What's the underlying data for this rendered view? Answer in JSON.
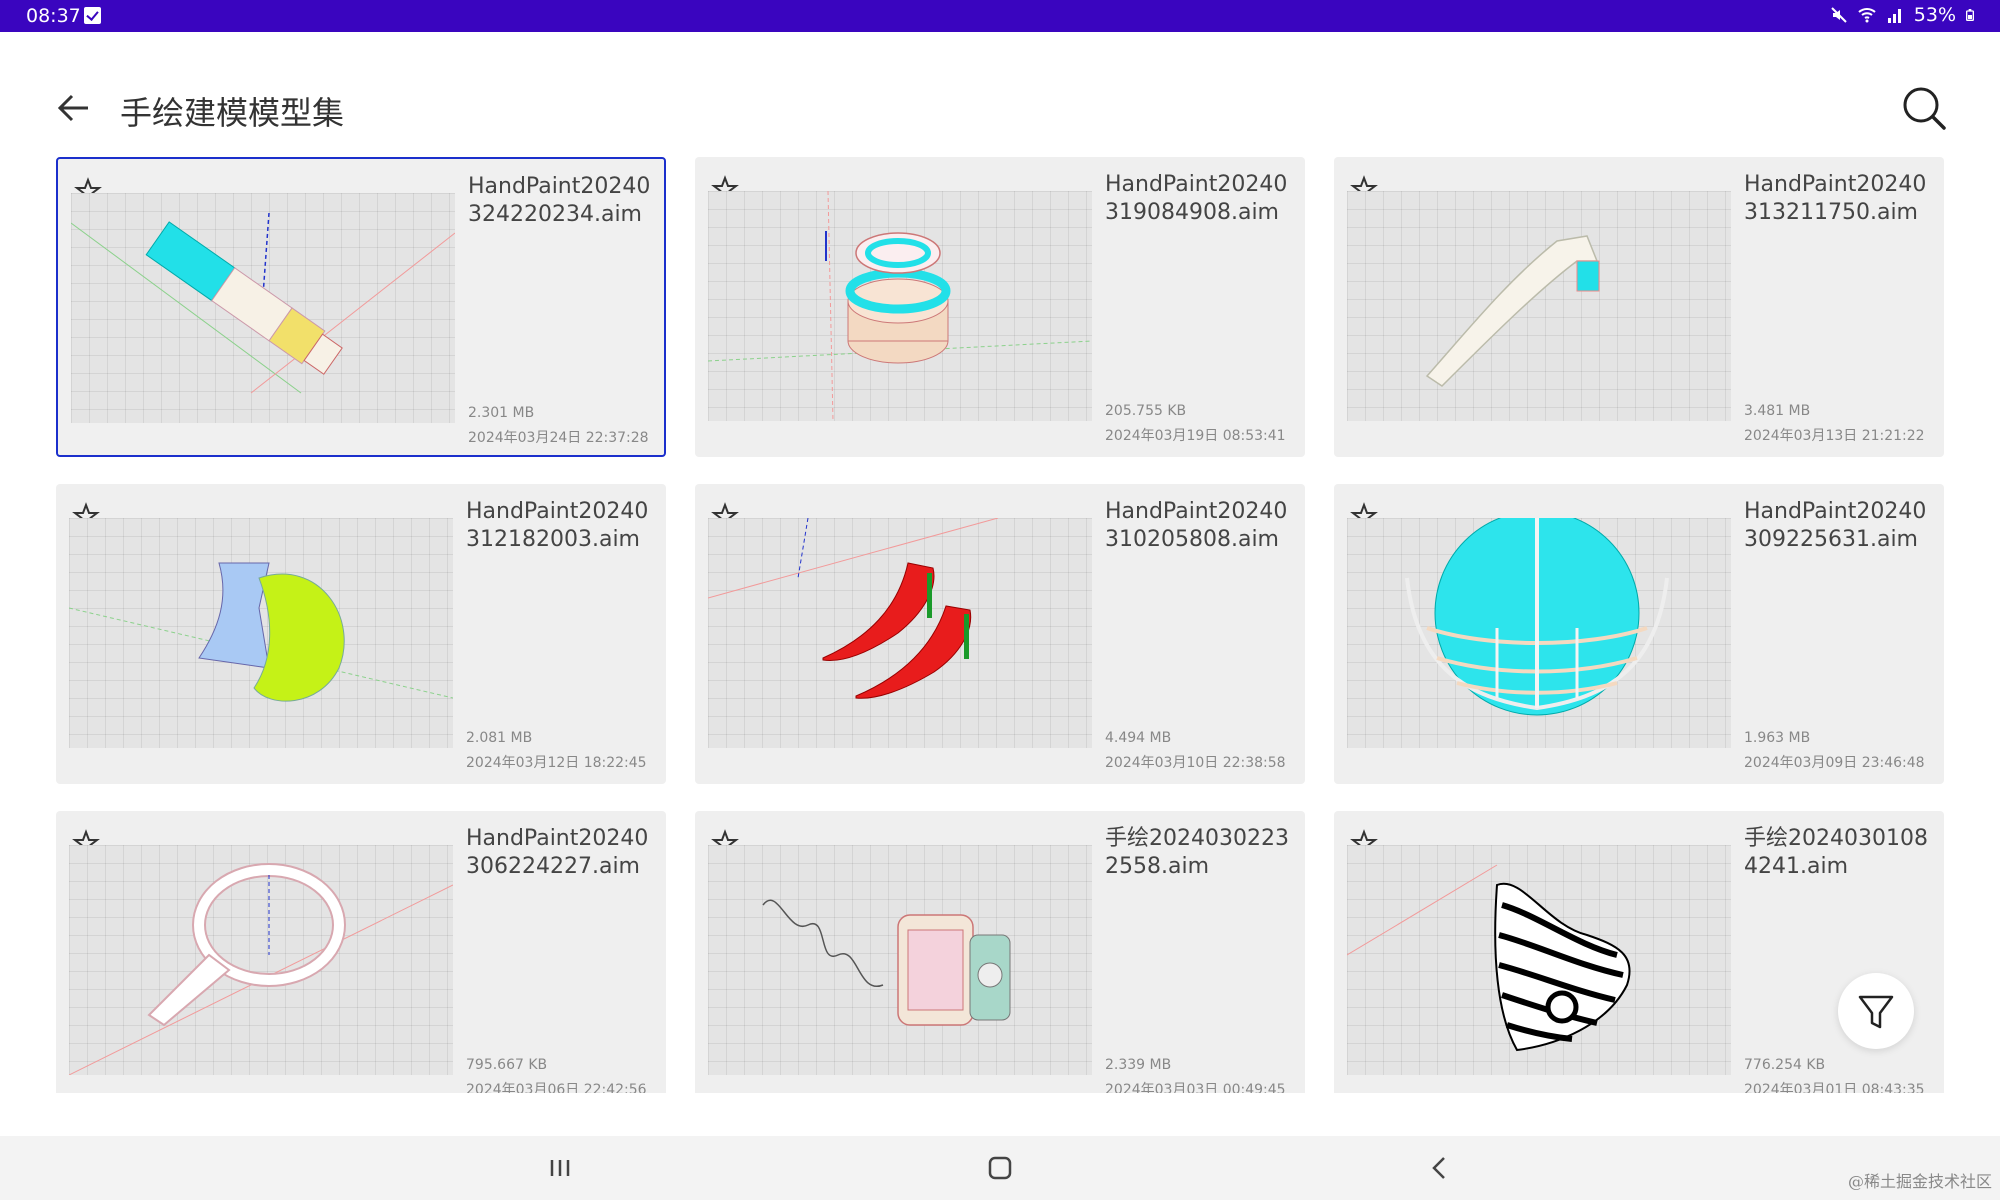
{
  "status_bar": {
    "time": "08:37",
    "battery": "53%"
  },
  "app_bar": {
    "title": "手绘建模模型集"
  },
  "files": [
    {
      "name": "HandPaint20240324220234.aim",
      "size": "2.301 MB",
      "date": "2024年03月24日 22:37:28",
      "selected": true,
      "model": "pen"
    },
    {
      "name": "HandPaint20240319084908.aim",
      "size": "205.755 KB",
      "date": "2024年03月19日 08:53:41",
      "selected": false,
      "model": "rings"
    },
    {
      "name": "HandPaint20240313211750.aim",
      "size": "3.481 MB",
      "date": "2024年03月13日 21:21:22",
      "selected": false,
      "model": "faucet"
    },
    {
      "name": "HandPaint20240312182003.aim",
      "size": "2.081 MB",
      "date": "2024年03月12日 18:22:45",
      "selected": false,
      "model": "shell"
    },
    {
      "name": "HandPaint20240310205808.aim",
      "size": "4.494 MB",
      "date": "2024年03月10日 22:38:58",
      "selected": false,
      "model": "heels"
    },
    {
      "name": "HandPaint20240309225631.aim",
      "size": "1.963 MB",
      "date": "2024年03月09日 23:46:48",
      "selected": false,
      "model": "sphere"
    },
    {
      "name": "HandPaint20240306224227.aim",
      "size": "795.667 KB",
      "date": "2024年03月06日 22:42:56",
      "selected": false,
      "model": "magnifier"
    },
    {
      "name": "手绘20240302232558.aim",
      "size": "2.339 MB",
      "date": "2024年03月03日 00:49:45",
      "selected": false,
      "model": "box"
    },
    {
      "name": "手绘20240301084241.aim",
      "size": "776.254 KB",
      "date": "2024年03月01日 08:43:35",
      "selected": false,
      "model": "zebra"
    }
  ],
  "icons": {
    "back": "arrow-left-icon",
    "search": "search-icon",
    "favorite": "star-outline-icon",
    "filter": "filter-icon"
  },
  "colors": {
    "status_bar": "#3a05bf",
    "selection": "#1b2fcc",
    "accent_cyan": "#22e0e8"
  },
  "watermark": "@稀土掘金技术社区"
}
